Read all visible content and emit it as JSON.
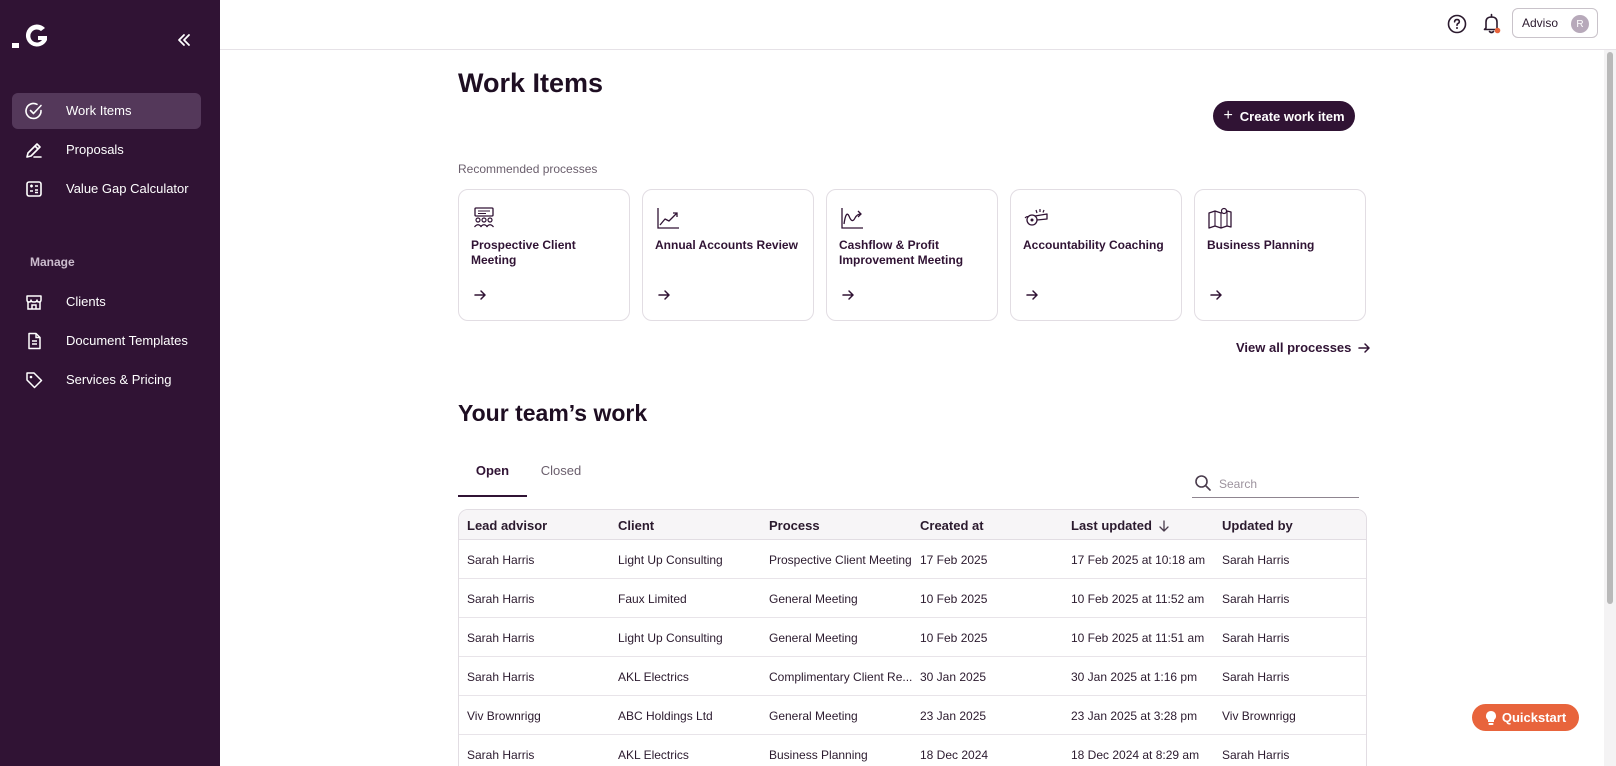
{
  "sidebar": {
    "items": [
      {
        "label": "Work Items",
        "icon": "check-circle-icon"
      },
      {
        "label": "Proposals",
        "icon": "pen-icon"
      },
      {
        "label": "Value Gap Calculator",
        "icon": "calculator-icon"
      }
    ],
    "manage_label": "Manage",
    "manage_items": [
      {
        "label": "Clients",
        "icon": "storefront-icon"
      },
      {
        "label": "Document Templates",
        "icon": "document-icon"
      },
      {
        "label": "Services & Pricing",
        "icon": "tag-icon"
      }
    ]
  },
  "topbar": {
    "account_label": "Adviso",
    "avatar_initial": "R"
  },
  "main": {
    "title": "Work Items",
    "create_button": "Create work item",
    "recommended_label": "Recommended processes",
    "processes": [
      {
        "title": "Prospective Client Meeting",
        "icon": "presentation-icon"
      },
      {
        "title": "Annual Accounts Review",
        "icon": "line-chart-icon"
      },
      {
        "title": "Cashflow & Profit Improvement Meeting",
        "icon": "trend-icon"
      },
      {
        "title": "Accountability Coaching",
        "icon": "whistle-icon"
      },
      {
        "title": "Business Planning",
        "icon": "map-icon"
      }
    ],
    "view_all": "View all processes",
    "team_title": "Your team’s work",
    "tabs": [
      {
        "label": "Open",
        "active": true
      },
      {
        "label": "Closed",
        "active": false
      }
    ],
    "search_placeholder": "Search",
    "table": {
      "headers": [
        "Lead advisor",
        "Client",
        "Process",
        "Created at",
        "Last updated",
        "Updated by"
      ],
      "sorted_column": "Last updated",
      "rows": [
        [
          "Sarah Harris",
          "Light Up Consulting",
          "Prospective Client Meeting",
          "17 Feb 2025",
          "17 Feb 2025 at 10:18 am",
          "Sarah Harris"
        ],
        [
          "Sarah Harris",
          "Faux Limited",
          "General Meeting",
          "10 Feb 2025",
          "10 Feb 2025 at 11:52 am",
          "Sarah Harris"
        ],
        [
          "Sarah Harris",
          "Light Up Consulting",
          "General Meeting",
          "10 Feb 2025",
          "10 Feb 2025 at 11:51 am",
          "Sarah Harris"
        ],
        [
          "Sarah Harris",
          "AKL Electrics",
          "Complimentary Client Re...",
          "30 Jan 2025",
          "30 Jan 2025 at 1:16 pm",
          "Sarah Harris"
        ],
        [
          "Viv Brownrigg",
          "ABC Holdings Ltd",
          "General Meeting",
          "23 Jan 2025",
          "23 Jan 2025 at 3:28 pm",
          "Viv Brownrigg"
        ],
        [
          "Sarah Harris",
          "AKL Electrics",
          "Business Planning",
          "18 Dec 2024",
          "18 Dec 2024 at 8:29 am",
          "Sarah Harris"
        ]
      ]
    }
  },
  "quickstart_label": "Quickstart",
  "colors": {
    "sidebar_bg": "#301334",
    "sidebar_active": "#54385a",
    "primary": "#301334",
    "quickstart": "#e8643c",
    "notification_dot": "#e8643c"
  }
}
